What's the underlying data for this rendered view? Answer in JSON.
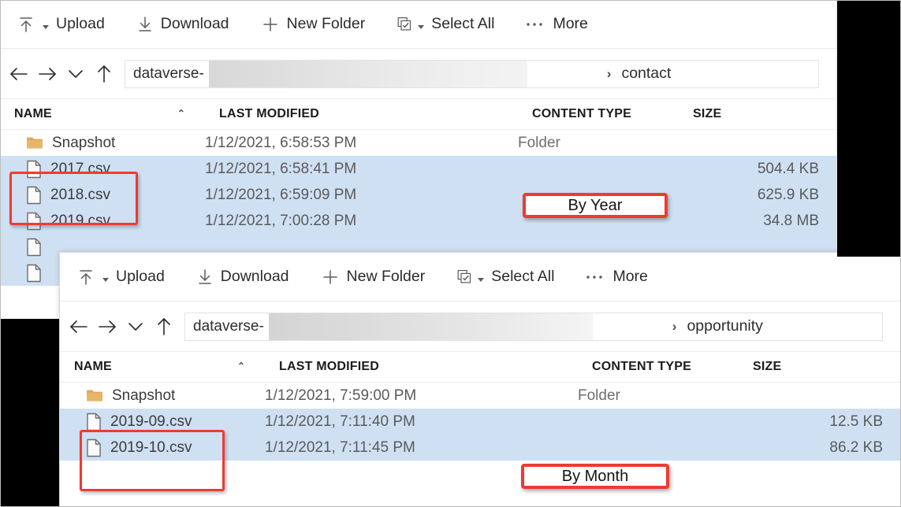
{
  "toolbar": {
    "upload": "Upload",
    "download": "Download",
    "new_folder": "New Folder",
    "select_all": "Select All",
    "more": "More",
    "icons": {
      "upload": "upload-arrow-icon",
      "download": "download-arrow-icon",
      "new_folder": "plus-icon",
      "select_all": "select-all-checkbox-icon",
      "more": "ellipsis-icon"
    }
  },
  "nav": {
    "back": "back-arrow",
    "forward": "forward-arrow",
    "recent": "chevron-down",
    "up": "up-arrow"
  },
  "columns": {
    "name": "NAME",
    "last_modified": "LAST MODIFIED",
    "content_type": "CONTENT TYPE",
    "size": "SIZE",
    "sort_indicator": "⌃"
  },
  "panel_contact": {
    "breadcrumb": {
      "prefix": "dataverse-",
      "separator": "›",
      "current": "contact"
    },
    "rows": [
      {
        "name": "Snapshot",
        "modified": "1/12/2021, 6:58:53 PM",
        "type": "Folder",
        "size": "",
        "kind": "folder",
        "selected": false
      },
      {
        "name": "2017.csv",
        "modified": "1/12/2021, 6:58:41 PM",
        "type": "",
        "size": "504.4 KB",
        "kind": "file",
        "selected": true
      },
      {
        "name": "2018.csv",
        "modified": "1/12/2021, 6:59:09 PM",
        "type": "",
        "size": "625.9 KB",
        "kind": "file",
        "selected": true
      },
      {
        "name": "2019.csv",
        "modified": "1/12/2021, 7:00:28 PM",
        "type": "",
        "size": "34.8 MB",
        "kind": "file",
        "selected": true
      },
      {
        "name": "",
        "modified": "",
        "type": "",
        "size": "",
        "kind": "file",
        "selected": true
      },
      {
        "name": "",
        "modified": "",
        "type": "",
        "size": "",
        "kind": "file",
        "selected": true
      }
    ]
  },
  "panel_opportunity": {
    "breadcrumb": {
      "prefix": "dataverse-",
      "separator": "›",
      "current": "opportunity"
    },
    "rows": [
      {
        "name": "Snapshot",
        "modified": "1/12/2021, 7:59:00 PM",
        "type": "Folder",
        "size": "",
        "kind": "folder",
        "selected": false
      },
      {
        "name": "2019-09.csv",
        "modified": "1/12/2021, 7:11:40 PM",
        "type": "",
        "size": "12.5 KB",
        "kind": "file",
        "selected": true
      },
      {
        "name": "2019-10.csv",
        "modified": "1/12/2021, 7:11:45 PM",
        "type": "",
        "size": "86.2 KB",
        "kind": "file",
        "selected": true
      }
    ]
  },
  "annotations": {
    "by_year": "By Year",
    "by_month": "By Month",
    "accent_color": "#f03a30",
    "selection_color": "#cfe0f3"
  }
}
